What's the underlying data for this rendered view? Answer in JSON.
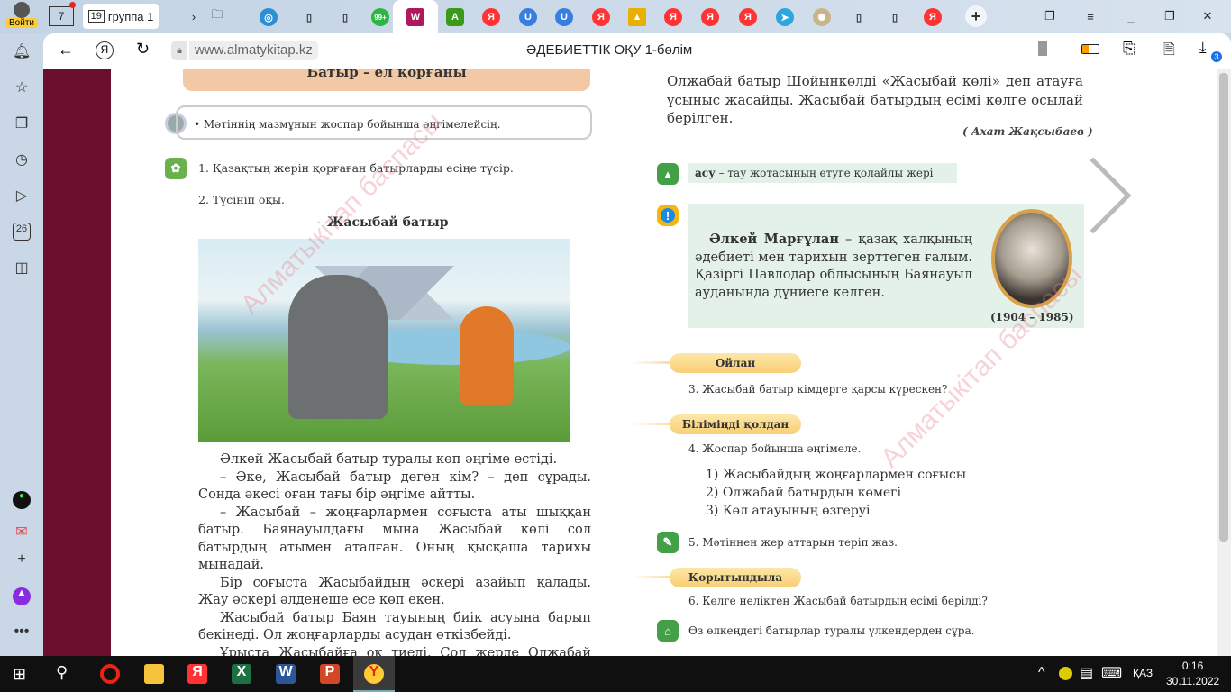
{
  "browser": {
    "login_label": "Войти",
    "home_badge": "7",
    "group_tab": {
      "count": "19",
      "label": "группа 1"
    },
    "address": "www.almatykitap.kz",
    "page_title": "ӘДЕБИЕТТІК ОҚУ 1-бөлім",
    "downloads_badge": "3",
    "whatsapp_badge": "99+",
    "sidebar_calendar": "26"
  },
  "book": {
    "banner_title": "Батыр – ел қорғаны",
    "goal": "• Мәтіннің мазмұнын жоспар бойынша әңгімелейсің.",
    "task1": "1. Қазақтың жерін қорғаған батырларды есіңе түсір.",
    "task2": "2. Түсініп оқы.",
    "story_title": "Жасыбай батыр",
    "watermark": "Алматыкітап баспасы",
    "paragraphs": [
      "Әлкей Жасыбай батыр туралы көп әңгіме естіді.",
      "– Әке, Жасыбай батыр деген кім? – деп сұрады. Сонда әкесі оған тағы бір әңгіме айтты.",
      "– Жасыбай – жоңғарлармен соғыста аты шыққан батыр. Баянауылдағы мына Жасыбай көлі сол батырдың атымен аталған. Оның қысқаша тарихы мынадай.",
      "Бір соғыста Жасыбайдың әскері азайып қалады. Жау әскері әлденеше есе көп екен.",
      "Жасыбай батыр Баян тауының биік асуына барып бекінеді. Ол жоңғарларды асудан өткізбейді.",
      "Ұрыста Жасыбайға оқ тиеді. Сол жерде Олжабай батырдың әскері көмекке келеді. Жоңғарлар жеңіледі."
    ],
    "right_top": "Олжабай батыр Шойынкөлді «Жасыбай көлі» деп атауға ұсыныс жасайды. Жасыбай батырдың есімі көлге осылай берілген.",
    "author": "( Ахат Жақсыбаев )",
    "dictionary": {
      "term": "асу",
      "definition": " – тау жотасының өтуге қолайлы жері"
    },
    "info": {
      "name": "Әлкей Марғұлан",
      "text": " – қазақ халқының әдебиеті мен тарихын зерттеген ғалым. Қазіргі Павлодар облысының Баянауыл ауданында дүниеге келген.",
      "years": "(1904 – 1985)"
    },
    "think_label": "Ойлан",
    "task3": "3. Жасыбай батыр кімдерге қарсы күрескен?",
    "apply_label": "Біліміңді қолдан",
    "task4": "4. Жоспар бойынша әңгімеле.",
    "plan": [
      "1) Жасыбайдың жоңғарлармен соғысы",
      "2) Олжабай батырдың көмегі",
      "3) Көл атауының өзгеруі"
    ],
    "task5": "5. Мәтіннен жер аттарын теріп жаз.",
    "conclude_label": "Қорытындыла",
    "task6": "6. Көлге неліктен Жасыбай батырдың есімі берілді?",
    "home_task": "Өз өлкеңдегі батырлар туралы үлкендерден сұра."
  },
  "taskbar": {
    "lang": "ҚАЗ",
    "time": "0:16",
    "date": "30.11.2022"
  }
}
